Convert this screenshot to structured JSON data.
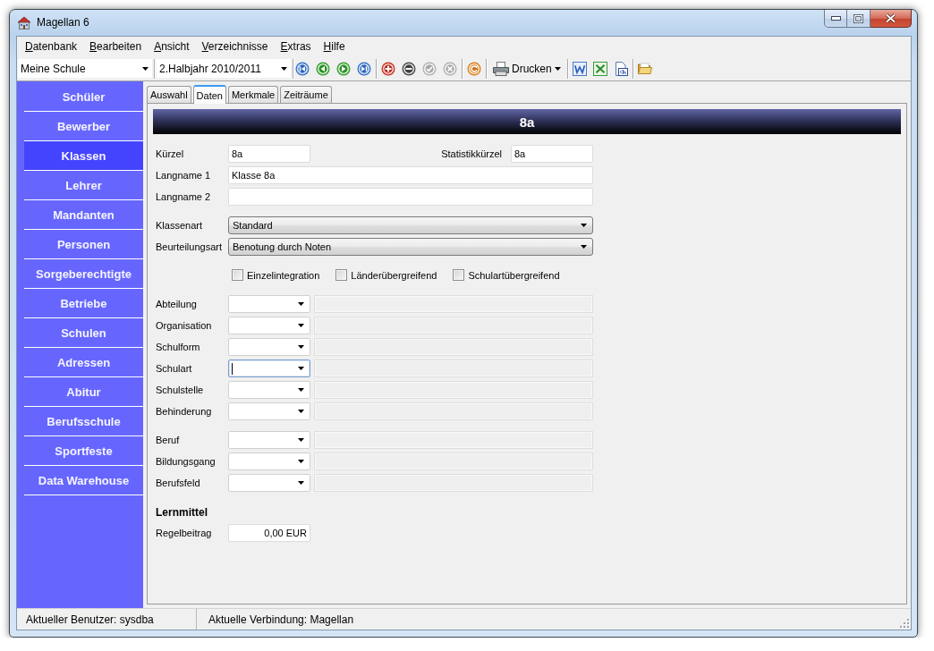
{
  "window": {
    "title": "Magellan 6"
  },
  "menu": [
    {
      "label": "Datenbank"
    },
    {
      "label": "Bearbeiten"
    },
    {
      "label": "Ansicht"
    },
    {
      "label": "Verzeichnisse"
    },
    {
      "label": "Extras"
    },
    {
      "label": "Hilfe"
    }
  ],
  "toolbar": {
    "selectors": [
      {
        "value": "Meine Schule"
      },
      {
        "value": "2.Halbjahr 2010/2011"
      }
    ],
    "groups": [
      [
        {
          "kind": "first",
          "disabled": false
        },
        {
          "kind": "previous",
          "disabled": false
        },
        {
          "kind": "next",
          "disabled": false
        },
        {
          "kind": "last",
          "disabled": false
        }
      ],
      [
        {
          "kind": "add",
          "disabled": false
        },
        {
          "kind": "remove",
          "disabled": false
        },
        {
          "kind": "confirm",
          "disabled": true
        },
        {
          "kind": "cancel",
          "disabled": true
        }
      ],
      [
        {
          "kind": "refresh",
          "disabled": false
        }
      ],
      [
        {
          "kind": "print",
          "label": "Drucken",
          "disabled": false
        }
      ],
      [
        {
          "kind": "doc",
          "disabled": false
        },
        {
          "kind": "sheet",
          "disabled": false
        },
        {
          "kind": "code",
          "disabled": false
        }
      ],
      [
        {
          "kind": "folder",
          "disabled": false
        }
      ]
    ]
  },
  "sidebar": {
    "items": [
      {
        "label": "Schüler",
        "selected": false
      },
      {
        "label": "Bewerber",
        "selected": false
      },
      {
        "label": "Klassen",
        "selected": true
      },
      {
        "label": "Lehrer",
        "selected": false
      },
      {
        "label": "Mandanten",
        "selected": false
      },
      {
        "label": "Personen",
        "selected": false
      },
      {
        "label": "Sorgeberechtigte",
        "selected": false
      },
      {
        "label": "Betriebe",
        "selected": false
      },
      {
        "label": "Schulen",
        "selected": false
      },
      {
        "label": "Adressen",
        "selected": false
      },
      {
        "label": "Abitur",
        "selected": false
      },
      {
        "label": "Berufsschule",
        "selected": false
      },
      {
        "label": "Sportfeste",
        "selected": false
      },
      {
        "label": "Data Warehouse",
        "selected": false
      }
    ]
  },
  "tabs": [
    {
      "label": "Auswahl",
      "selected": false
    },
    {
      "label": "Daten",
      "selected": true
    },
    {
      "label": "Merkmale",
      "selected": false
    },
    {
      "label": "Zeiträume",
      "selected": false
    }
  ],
  "record": {
    "title": "8a",
    "short_name": {
      "label": "Kürzel",
      "value": "8a"
    },
    "statistics_code": {
      "label": "Statistikkürzel",
      "value": "8a"
    },
    "long_names": [
      {
        "label": "Langname 1",
        "value": "Klasse 8a"
      },
      {
        "label": "Langname 2"
      }
    ],
    "selects": [
      {
        "label": "Klassenart",
        "value": "Standard"
      },
      {
        "label": "Beurteilungsart",
        "value": "Benotung durch Noten"
      }
    ],
    "checkboxes": [
      {
        "label": "Einzelintegration",
        "checked": false
      },
      {
        "label": "Länderübergreifend",
        "checked": false
      },
      {
        "label": "Schulartübergreifend",
        "checked": false
      }
    ],
    "lookup_groups": [
      [
        {
          "label": "Abteilung",
          "focused": false
        },
        {
          "label": "Organisation",
          "focused": false
        },
        {
          "label": "Schulform",
          "focused": false
        },
        {
          "label": "Schulart",
          "focused": true
        },
        {
          "label": "Schulstelle",
          "focused": false
        },
        {
          "label": "Behinderung",
          "focused": false
        }
      ],
      [
        {
          "label": "Beruf",
          "focused": false
        },
        {
          "label": "Bildungsgang",
          "focused": false
        },
        {
          "label": "Berufsfeld",
          "focused": false
        }
      ]
    ],
    "section_title": "Lernmittel",
    "fee": {
      "label": "Regelbeitrag",
      "value": "0,00 EUR"
    }
  },
  "status_bar": [
    {
      "text": "Aktueller Benutzer: sysdba"
    },
    {
      "text": "Aktuelle Verbindung: Magellan"
    }
  ]
}
